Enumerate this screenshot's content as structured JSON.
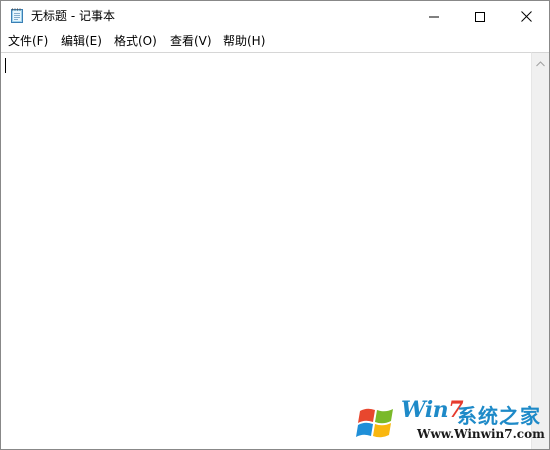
{
  "window": {
    "title": "无标题 - 记事本",
    "icon": "notepad-icon"
  },
  "title_buttons": [
    {
      "name": "minimize",
      "icon": "minimize-icon"
    },
    {
      "name": "maximize",
      "icon": "maximize-icon"
    },
    {
      "name": "close",
      "icon": "close-icon"
    }
  ],
  "menu": [
    {
      "label": "文件(F)"
    },
    {
      "label": "编辑(E)"
    },
    {
      "label": "格式(O)"
    },
    {
      "label": "查看(V)"
    },
    {
      "label": "帮助(H)"
    }
  ],
  "editor": {
    "content": ""
  },
  "scrollbar": {
    "up_icon": "chevron-up-icon"
  },
  "watermark": {
    "brand_prefix": "Win",
    "brand_seven": "7",
    "brand_cn": "系统之家",
    "url": "Www.Winwin7.com",
    "colors": {
      "blue": "#1e8ac8",
      "red": "#e63b2e"
    }
  }
}
